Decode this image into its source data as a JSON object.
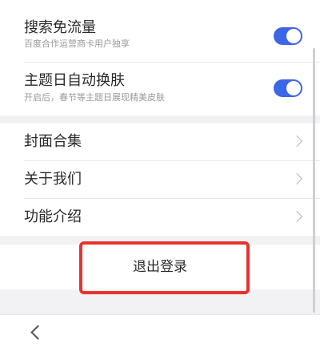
{
  "settings": [
    {
      "title": "搜索免流量",
      "subtitle": "百度合作运营商卡用户独享",
      "toggle_on": true
    },
    {
      "title": "主题日自动换肤",
      "subtitle": "开启后，春节等主题日展现精美皮肤",
      "toggle_on": true
    }
  ],
  "menu": [
    {
      "label": "封面合集",
      "icon": "chevron-right-icon"
    },
    {
      "label": "关于我们",
      "icon": "chevron-right-icon"
    },
    {
      "label": "功能介绍",
      "icon": "chevron-right-icon"
    }
  ],
  "logout": {
    "label": "退出登录",
    "highlight_color": "#e8322f"
  },
  "bottom_nav": {
    "back_icon": "chevron-left-icon"
  },
  "colors": {
    "toggle_on": "#3b66e6",
    "background": "#f2f2f4"
  }
}
